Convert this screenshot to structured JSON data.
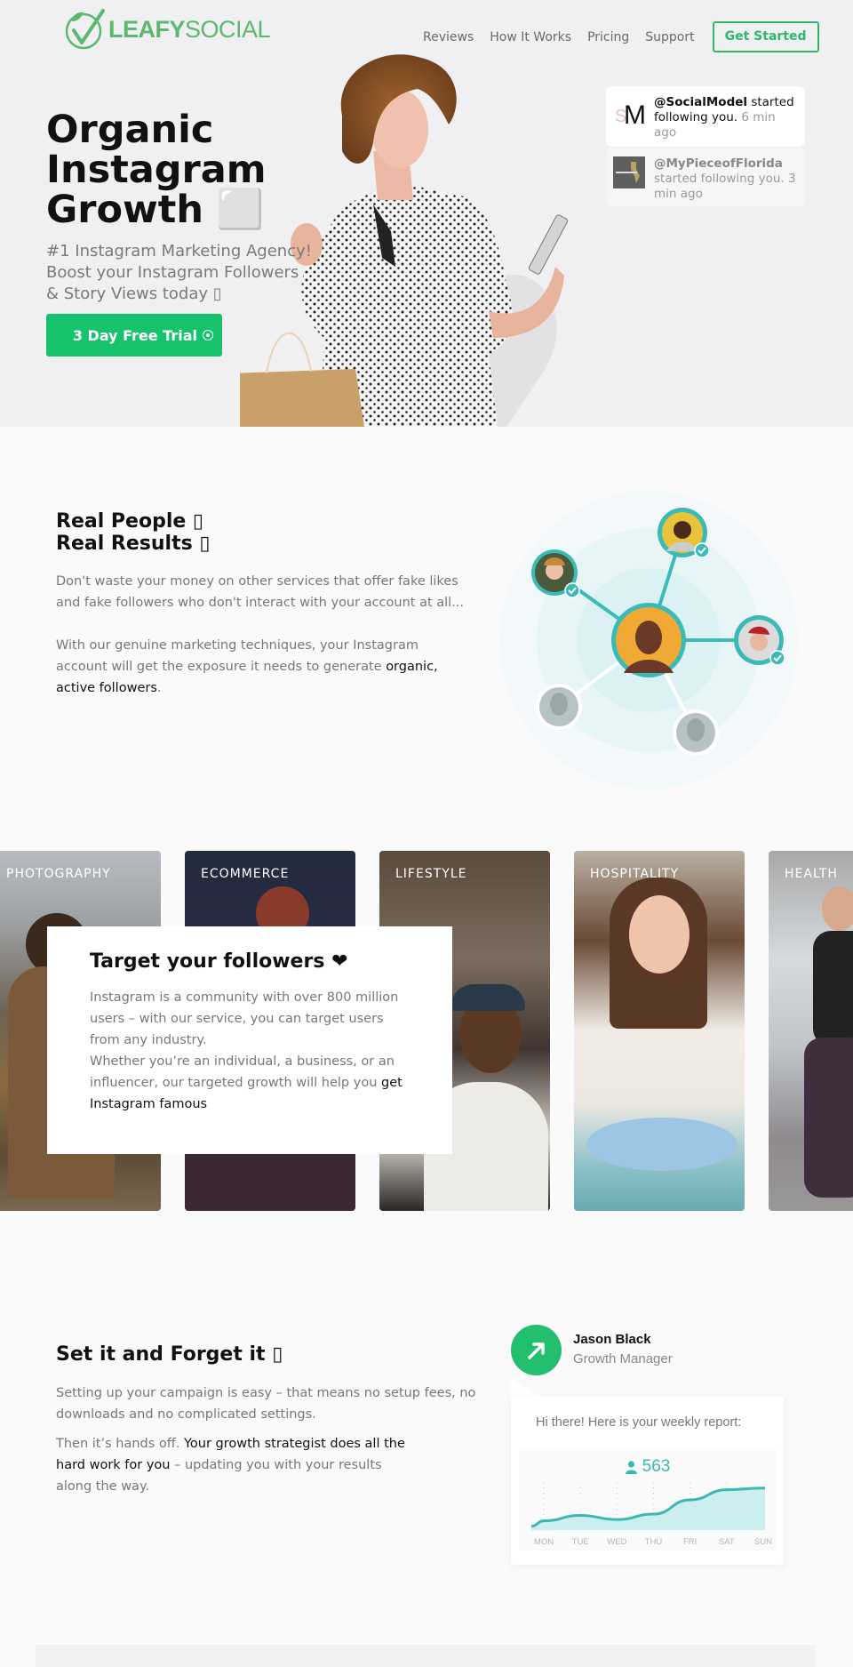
{
  "brand": {
    "name_bold": "LEAFY",
    "name_light": "SOCIAL",
    "color": "#5cb86e"
  },
  "nav": {
    "items": [
      {
        "label": "Reviews"
      },
      {
        "label": "How It Works"
      },
      {
        "label": "Pricing"
      },
      {
        "label": "Support"
      }
    ],
    "cta_label": "Get Started",
    "cta_color": "#2eb86a"
  },
  "hero": {
    "title_lines": [
      "Organic",
      "Instagram",
      "Growth ⬜"
    ],
    "subtitle_lines": [
      "#1 Instagram Marketing Agency!",
      "Boost your Instagram Followers",
      "& Story Views today ▯"
    ],
    "button_label": "3 Day Free Trial",
    "button_icon": "circle-dot-icon",
    "button_color": "#17c26c"
  },
  "notifications": [
    {
      "avatar": "SM",
      "handle": "@SocialModel",
      "action": "started following you.",
      "time": "6 min ago"
    },
    {
      "avatar": "MY PIECE OF FLORIDA",
      "handle": "@MyPieceofFlorida",
      "action": "started following you.",
      "time": "3 min ago"
    }
  ],
  "real_people": {
    "title_line1": "Real People ▯",
    "title_line2": "Real Results ▯",
    "para1": "Don't waste your money on other services that offer fake likes and fake followers who don't interact with your account at all...",
    "para2_pre": "With our genuine marketing techniques, your Instagram account will get the exposure it needs to generate ",
    "para2_hl": "organic, active followers",
    "para2_post": ".",
    "network_color": "#3bbab8"
  },
  "industries": [
    {
      "label": "PHOTOGRAPHY"
    },
    {
      "label": "ECOMMERCE"
    },
    {
      "label": "LIFESTYLE"
    },
    {
      "label": "HOSPITALITY"
    },
    {
      "label": "HEALTH"
    }
  ],
  "target": {
    "title": "Target your followers ❤",
    "para_1": "Instagram is a community with over 800 million users – with our service, you can target users from any industry.",
    "para_2": "Whether you’re an individual, a business, or an influencer, our targeted growth will help you ",
    "para_hl": "get Instagram famous"
  },
  "set_it": {
    "title": "Set it and Forget it ▯",
    "para1": "Setting up your campaign is easy – that means no setup fees, no downloads and no complicated settings.",
    "para2_pre": "Then it’s hands off. ",
    "para2_hl": "Your growth strategist does all the hard work for you",
    "para2_post": " – updating you with your results along the way."
  },
  "manager": {
    "name": "Jason Black",
    "role": "Growth Manager",
    "greeting": "Hi there! Here is your weekly report:",
    "follower_count": "563",
    "accent": "#3bb8b6"
  },
  "chart_data": {
    "type": "area",
    "title": "",
    "categories": [
      "MON",
      "TUE",
      "WED",
      "THU",
      "FRI",
      "SAT",
      "SUN"
    ],
    "values": [
      22,
      35,
      25,
      38,
      72,
      96,
      100
    ],
    "unit": "relative growth",
    "xlabel": "",
    "ylabel": "",
    "ylim": [
      0,
      110
    ],
    "grid": "vertical-dotted",
    "legend": "none"
  }
}
